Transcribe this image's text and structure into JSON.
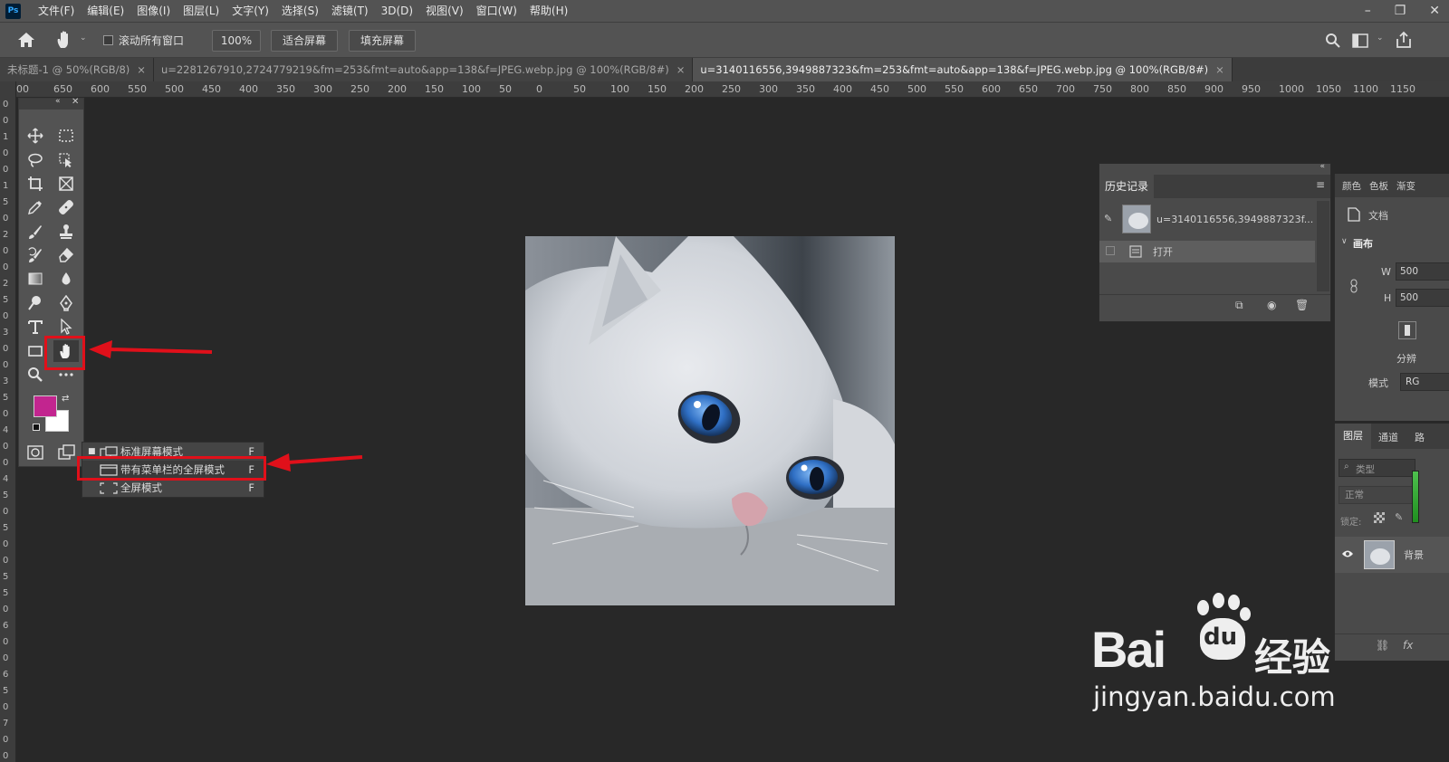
{
  "app": {
    "logo": "Ps"
  },
  "menubar": {
    "items": [
      "文件(F)",
      "编辑(E)",
      "图像(I)",
      "图层(L)",
      "文字(Y)",
      "选择(S)",
      "滤镜(T)",
      "3D(D)",
      "视图(V)",
      "窗口(W)",
      "帮助(H)"
    ]
  },
  "options": {
    "scroll_all_label": "滚动所有窗口",
    "zoom_value": "100%",
    "fit_screen": "适合屏幕",
    "fill_screen": "填充屏幕"
  },
  "tabs": [
    {
      "label": "未标题-1 @ 50%(RGB/8)",
      "close": "×"
    },
    {
      "label": "u=2281267910,2724779219&fm=253&fmt=auto&app=138&f=JPEG.webp.jpg @ 100%(RGB/8#)",
      "close": "×"
    },
    {
      "label": "u=3140116556,3949887323&fm=253&fmt=auto&app=138&f=JPEG.webp.jpg @ 100%(RGB/8#)",
      "close": "×"
    }
  ],
  "hruler_labels": [
    "00",
    "650",
    "600",
    "550",
    "500",
    "450",
    "400",
    "350",
    "300",
    "250",
    "200",
    "150",
    "100",
    "50",
    "0",
    "50",
    "100",
    "150",
    "200",
    "250",
    "300",
    "350",
    "400",
    "450",
    "500",
    "550",
    "600",
    "650",
    "700",
    "750",
    "800",
    "850",
    "900",
    "950",
    "1000",
    "1050",
    "1100",
    "1150"
  ],
  "vruler_labels": [
    "0",
    "0",
    "1",
    "0",
    "0",
    "1",
    "5",
    "0",
    "2",
    "0",
    "0",
    "2",
    "5",
    "0",
    "3",
    "0",
    "0",
    "3",
    "5",
    "0",
    "4",
    "0",
    "0",
    "4",
    "5",
    "0",
    "5",
    "0",
    "0",
    "5",
    "5",
    "0",
    "6",
    "0",
    "0",
    "6",
    "5",
    "0",
    "7",
    "0",
    "0"
  ],
  "toolbar": {
    "icons": [
      "move-icon",
      "marquee-icon",
      "lasso-icon",
      "object-select-icon",
      "crop-icon",
      "frame-icon",
      "eyedropper-icon",
      "healing-icon",
      "brush-icon",
      "stamp-icon",
      "history-brush-icon",
      "eraser-icon",
      "gradient-icon",
      "blur-icon",
      "dodge-icon",
      "pen-icon",
      "type-icon",
      "path-select-icon",
      "rectangle-icon",
      "hand-icon",
      "zoom-icon",
      "more-icon"
    ],
    "foreground_color": "#c2258f",
    "background_color": "#ffffff"
  },
  "screen_mode_menu": {
    "items": [
      {
        "label": "标准屏幕模式",
        "key": "F",
        "selected": true
      },
      {
        "label": "带有菜单栏的全屏模式",
        "key": "F",
        "selected": false
      },
      {
        "label": "全屏模式",
        "key": "F",
        "selected": false
      }
    ]
  },
  "history_panel": {
    "tab": "历史记录",
    "snapshot_label": "u=3140116556,3949887323f...",
    "steps": [
      "打开"
    ]
  },
  "properties_panel": {
    "tabs": [
      "颜色",
      "色板",
      "渐变"
    ],
    "doc_label": "文档",
    "canvas_section": "画布",
    "w_label": "W",
    "w_value": "500",
    "h_label": "H",
    "h_value": "500",
    "resolution_label": "分辨",
    "mode_label": "模式",
    "mode_value": "RG"
  },
  "layers_panel": {
    "tabs": [
      "图层",
      "通道",
      "路"
    ],
    "search_placeholder": "类型",
    "blend_mode": "正常",
    "lock_label": "锁定:",
    "layer_name": "背景",
    "footer_fx": "fx"
  },
  "watermark": {
    "brand": "Bai",
    "brand2": "经验",
    "du": "du",
    "url": "jingyan.baidu.com"
  },
  "colors": {
    "accent_red": "#e0101a",
    "ui_bg": "#535353",
    "canvas_bg": "#282828"
  }
}
